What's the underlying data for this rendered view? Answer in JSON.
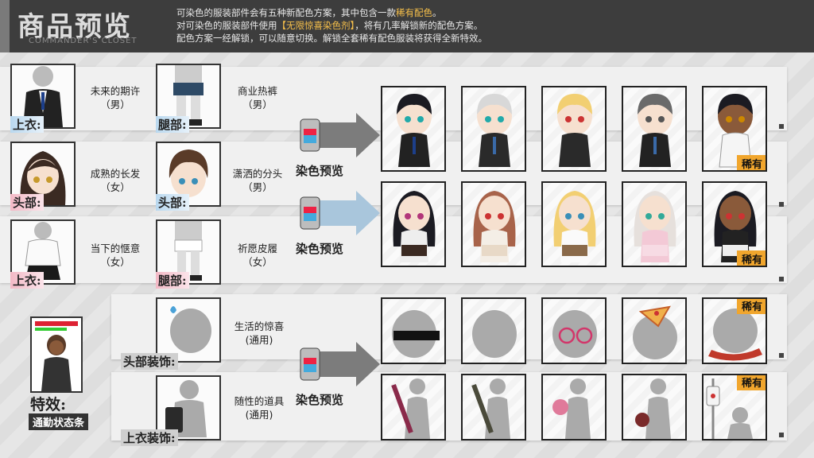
{
  "header": {
    "title": "商品预览",
    "subtitle": "COMMANDER'S CLOSET",
    "desc_line1_a": "可染色的服装部件会有五种新配色方案，其中包含一款",
    "desc_line1_hl": "稀有配色",
    "desc_line1_b": "。",
    "desc_line2_a": "对可染色的服装部件使用",
    "desc_line2_hl": "【无限惊喜染色剂】",
    "desc_line2_b": "，将有几率解锁新的配色方案。",
    "desc_line3": "配色方案一经解锁，可以随意切换。解锁全套稀有配色服装将获得全新特效。"
  },
  "items": [
    {
      "tag": "上衣:",
      "name1": "未来的期许",
      "name2": "（男）"
    },
    {
      "tag": "腿部:",
      "name1": "商业热裤",
      "name2": "（男）"
    },
    {
      "tag": "头部:",
      "name1": "成熟的长发",
      "name2": "（女）"
    },
    {
      "tag": "头部:",
      "name1": "潇洒的分头",
      "name2": "（男）"
    },
    {
      "tag": "上衣:",
      "name1": "当下的惬意",
      "name2": "（女）"
    },
    {
      "tag": "腿部:",
      "name1": "祈愿皮履",
      "name2": "（女）"
    },
    {
      "tag": "头部装饰:",
      "name1": "生活的惊喜",
      "name2": "(通用)"
    },
    {
      "tag": "上衣装饰:",
      "name1": "随性的道具",
      "name2": "(通用)"
    }
  ],
  "dye_label": "染色预览",
  "rare_label": "稀有",
  "effect": {
    "label": "特效:",
    "sub": "通勤状态条"
  },
  "colors": {
    "rare": "#f1a62d",
    "header": "#3d3d3d",
    "accent_blue": "#b9d8ef",
    "accent_pink": "#f3b9c6"
  }
}
